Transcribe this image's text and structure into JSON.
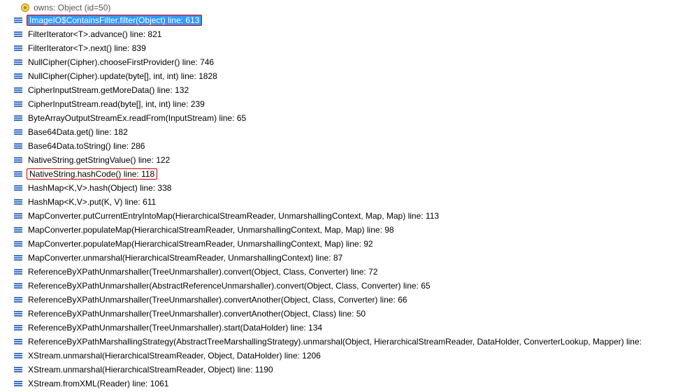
{
  "variable": {
    "text": "owns: Object  (id=50)"
  },
  "frames": [
    {
      "text": "ImageIO$ContainsFilter.filter(Object) line: 613",
      "highlight": true,
      "selected": true
    },
    {
      "text": "FilterIterator<T>.advance() line: 821"
    },
    {
      "text": "FilterIterator<T>.next() line: 839"
    },
    {
      "text": "NullCipher(Cipher).chooseFirstProvider() line: 746"
    },
    {
      "text": "NullCipher(Cipher).update(byte[], int, int) line: 1828"
    },
    {
      "text": "CipherInputStream.getMoreData() line: 132"
    },
    {
      "text": "CipherInputStream.read(byte[], int, int) line: 239"
    },
    {
      "text": "ByteArrayOutputStreamEx.readFrom(InputStream) line: 65"
    },
    {
      "text": "Base64Data.get() line: 182"
    },
    {
      "text": "Base64Data.toString() line: 286"
    },
    {
      "text": "NativeString.getStringValue() line: 122"
    },
    {
      "text": "NativeString.hashCode() line: 118",
      "highlight": true
    },
    {
      "text": "HashMap<K,V>.hash(Object) line: 338"
    },
    {
      "text": "HashMap<K,V>.put(K, V) line: 611"
    },
    {
      "text": "MapConverter.putCurrentEntryIntoMap(HierarchicalStreamReader, UnmarshallingContext, Map, Map) line: 113"
    },
    {
      "text": "MapConverter.populateMap(HierarchicalStreamReader, UnmarshallingContext, Map, Map) line: 98"
    },
    {
      "text": "MapConverter.populateMap(HierarchicalStreamReader, UnmarshallingContext, Map) line: 92"
    },
    {
      "text": "MapConverter.unmarshal(HierarchicalStreamReader, UnmarshallingContext) line: 87"
    },
    {
      "text": "ReferenceByXPathUnmarshaller(TreeUnmarshaller).convert(Object, Class, Converter) line: 72"
    },
    {
      "text": "ReferenceByXPathUnmarshaller(AbstractReferenceUnmarshaller).convert(Object, Class, Converter) line: 65"
    },
    {
      "text": "ReferenceByXPathUnmarshaller(TreeUnmarshaller).convertAnother(Object, Class, Converter) line: 66"
    },
    {
      "text": "ReferenceByXPathUnmarshaller(TreeUnmarshaller).convertAnother(Object, Class) line: 50"
    },
    {
      "text": "ReferenceByXPathUnmarshaller(TreeUnmarshaller).start(DataHolder) line: 134"
    },
    {
      "text": "ReferenceByXPathMarshallingStrategy(AbstractTreeMarshallingStrategy).unmarshal(Object, HierarchicalStreamReader, DataHolder, ConverterLookup, Mapper) line:"
    },
    {
      "text": "XStream.unmarshal(HierarchicalStreamReader, Object, DataHolder) line: 1206"
    },
    {
      "text": "XStream.unmarshal(HierarchicalStreamReader, Object) line: 1190"
    },
    {
      "text": "XStream.fromXML(Reader) line: 1061"
    }
  ]
}
